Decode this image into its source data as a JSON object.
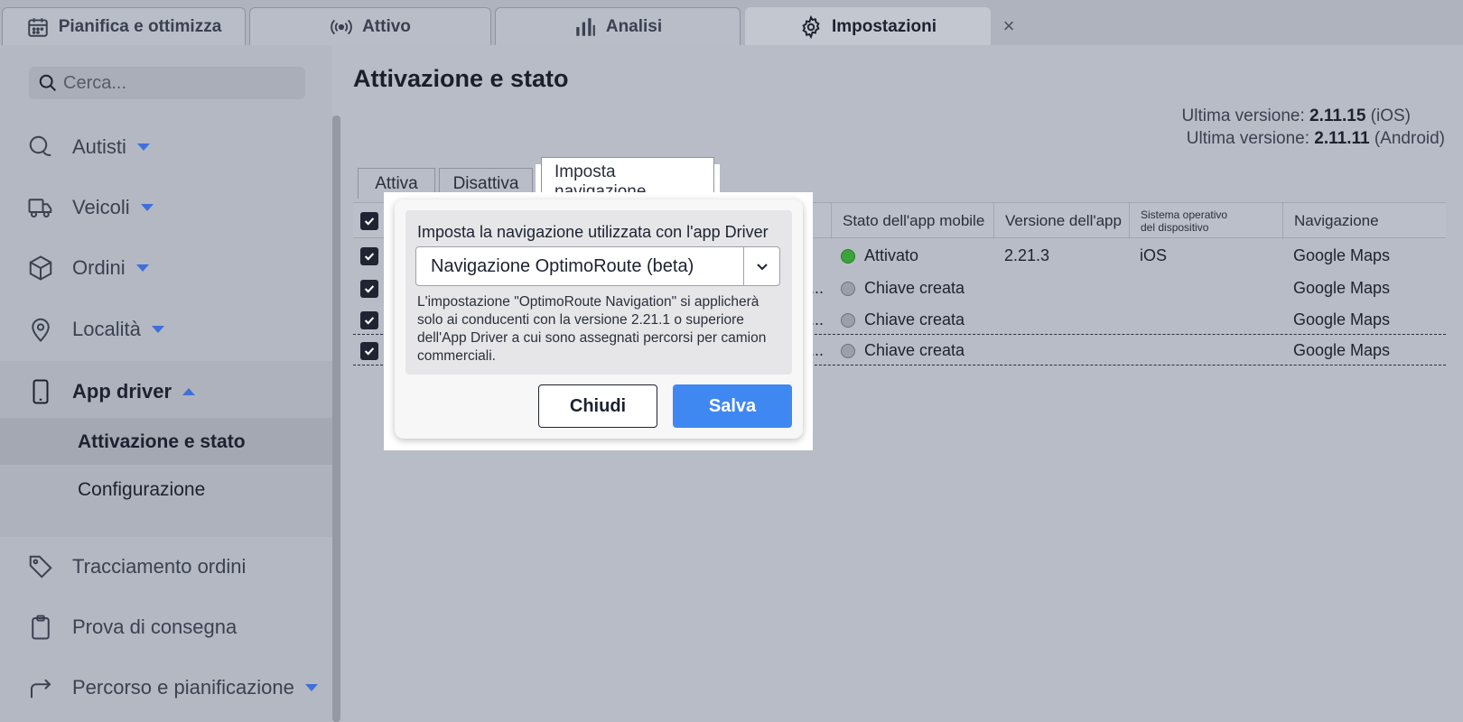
{
  "top_tabs": [
    {
      "label": "Pianifica e ottimizza",
      "icon": "calendar-icon"
    },
    {
      "label": "Attivo",
      "icon": "broadcast-icon"
    },
    {
      "label": "Analisi",
      "icon": "bar-chart-icon"
    },
    {
      "label": "Impostazioni",
      "icon": "gear-icon"
    }
  ],
  "search": {
    "placeholder": "Cerca..."
  },
  "sidebar": {
    "items": [
      {
        "label": "Autisti",
        "icon": "drivers-icon"
      },
      {
        "label": "Veicoli",
        "icon": "truck-icon"
      },
      {
        "label": "Ordini",
        "icon": "box-icon"
      },
      {
        "label": "Località",
        "icon": "location-pin-icon"
      },
      {
        "label": "App driver",
        "icon": "mobile-phone-icon"
      },
      {
        "label": "Tracciamento ordini",
        "icon": "tag-icon"
      },
      {
        "label": "Prova di consegna",
        "icon": "clipboard-icon"
      },
      {
        "label": "Percorso e pianificazione",
        "icon": "route-arrow-icon"
      }
    ],
    "sub_items": [
      {
        "label": "Attivazione e stato"
      },
      {
        "label": "Configurazione"
      }
    ]
  },
  "page": {
    "title": "Attivazione e stato",
    "version_ios_prefix": "Ultima versione: ",
    "version_ios": "2.11.15",
    "version_ios_suffix": " (iOS)",
    "version_android_prefix": "Ultima versione: ",
    "version_android": "2.11.11",
    "version_android_suffix": " (Android)"
  },
  "sub_tabs": [
    {
      "label": "Attiva"
    },
    {
      "label": "Disattiva"
    },
    {
      "label": "Imposta navigazione"
    }
  ],
  "table": {
    "headers": [
      "Stato dell'app mobile",
      "Versione dell'app",
      "Sistema operativo del dispositivo",
      "Navigazione"
    ],
    "rows": [
      {
        "truncated": "",
        "status": "Attivato",
        "status_color": "#3aa43a",
        "version": "2.21.3",
        "os": "iOS",
        "navigation": "Google Maps"
      },
      {
        "truncated": "O...",
        "status": "Chiave creata",
        "status_color": "#9a9fa8",
        "version": "",
        "os": "",
        "navigation": "Google Maps"
      },
      {
        "truncated": "O...",
        "status": "Chiave creata",
        "status_color": "#9a9fa8",
        "version": "",
        "os": "",
        "navigation": "Google Maps"
      },
      {
        "truncated": "O...",
        "status": "Chiave creata",
        "status_color": "#9a9fa8",
        "version": "",
        "os": "",
        "navigation": "Google Maps"
      }
    ]
  },
  "modal": {
    "label": "Imposta la navigazione utilizzata con l'app Driver",
    "selected": "Navigazione OptimoRoute (beta)",
    "note": "L'impostazione \"OptimoRoute Navigation\" si applicherà solo ai conducenti con la versione 2.21.1 o superiore dell'App Driver a cui sono assegnati percorsi per camion commerciali.",
    "close_label": "Chiudi",
    "save_label": "Salva"
  },
  "colors": {
    "accent": "#3f88f2",
    "caret": "#3f6fd8",
    "status_active": "#3aa43a"
  }
}
